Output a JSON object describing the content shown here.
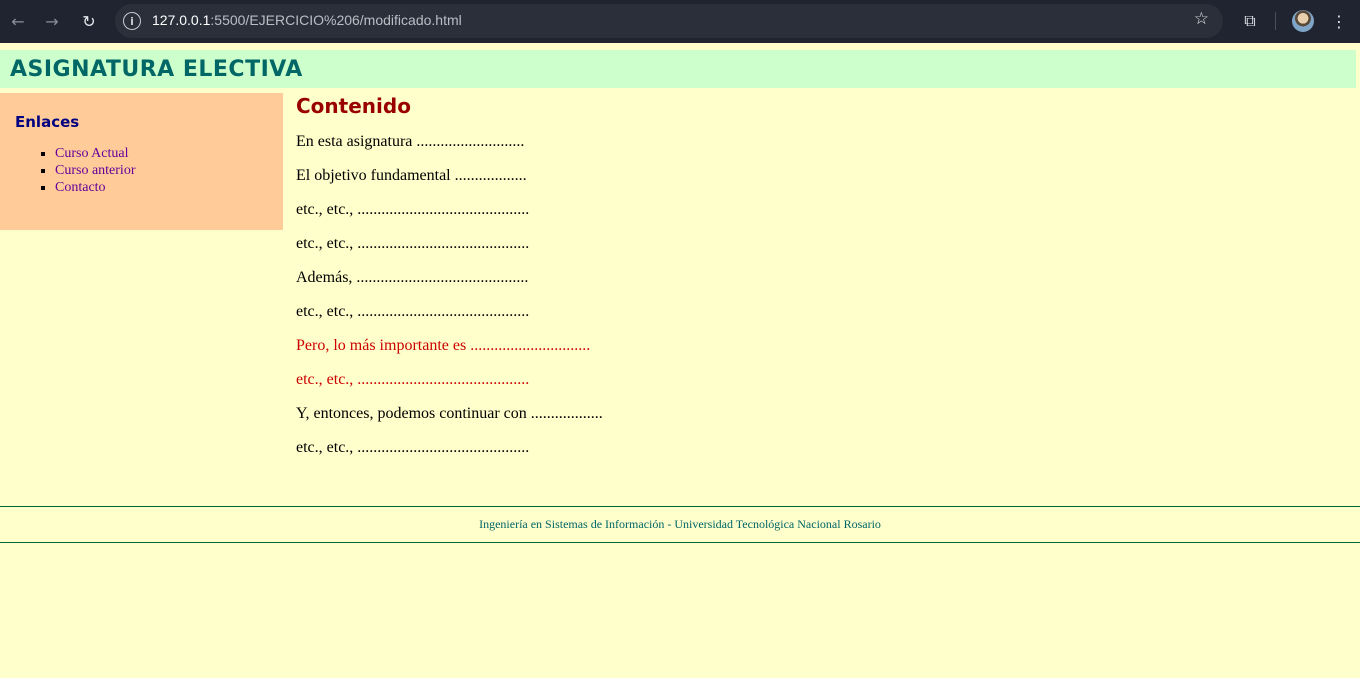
{
  "browser": {
    "url_host": "127.0.0.1",
    "url_rest": ":5500/EJERCICIO%206/modificado.html"
  },
  "header": {
    "title": "ASIGNATURA ELECTIVA"
  },
  "sidebar": {
    "title": "Enlaces",
    "links": [
      "Curso Actual",
      "Curso anterior",
      "Contacto"
    ]
  },
  "content": {
    "title": "Contenido",
    "paragraphs": [
      "En esta asignatura ...........................",
      "El objetivo fundamental ..................",
      "etc., etc., ...........................................",
      "etc., etc., ...........................................",
      "Además, ...........................................",
      "etc., etc., ...........................................",
      "Pero, lo más importante es ..............................",
      "etc., etc., ...........................................",
      "Y, entonces, podemos continuar con ..................",
      "etc., etc., ..........................................."
    ]
  },
  "footer": {
    "text": "Ingeniería en Sistemas de Información - Universidad Tecnológica Nacional Rosario"
  },
  "colors": {
    "page_bg": "#ffffcc",
    "header_bg": "#ccffcc",
    "header_text": "#006666",
    "sidebar_bg": "#ffcc99",
    "sidebar_title": "#000080",
    "link": "#660099",
    "content_title": "#990000",
    "highlight_text": "#cc0000",
    "footer_line": "#006633"
  }
}
